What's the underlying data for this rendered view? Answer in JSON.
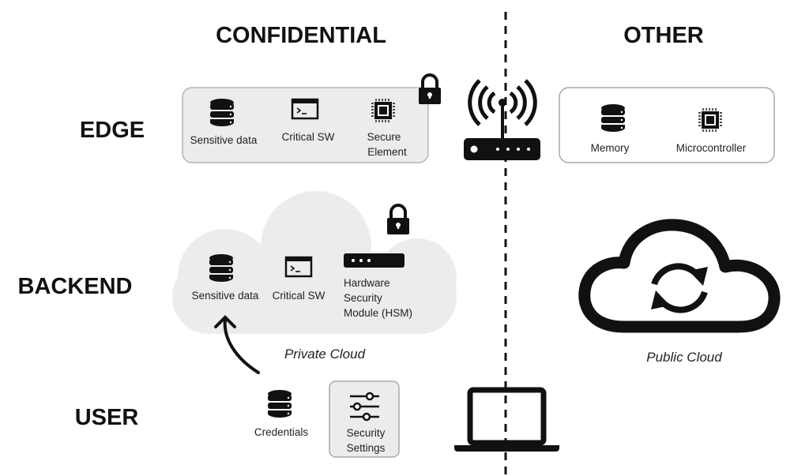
{
  "columns": {
    "confidential": "CONFIDENTIAL",
    "other": "OTHER"
  },
  "rows": {
    "edge": "EDGE",
    "backend": "BACKEND",
    "user": "USER"
  },
  "edge": {
    "confidential_items": [
      {
        "icon": "database-icon",
        "label": "Sensitive data"
      },
      {
        "icon": "terminal-icon",
        "label": "Critical SW"
      },
      {
        "icon": "chip-icon",
        "label_lines": [
          "Secure",
          "Element"
        ]
      }
    ],
    "device_icon": "wifi-router-icon",
    "other_items": [
      {
        "icon": "database-icon",
        "label": "Memory"
      },
      {
        "icon": "chip-icon",
        "label": "Microcontroller"
      }
    ]
  },
  "backend": {
    "private_cloud": {
      "caption": "Private Cloud",
      "items": [
        {
          "icon": "database-icon",
          "label": "Sensitive data"
        },
        {
          "icon": "terminal-icon",
          "label": "Critical SW"
        },
        {
          "icon": "hsm-icon",
          "label_lines": [
            "Hardware",
            "Security",
            "Module (HSM)"
          ]
        }
      ]
    },
    "public_cloud": {
      "caption": "Public Cloud",
      "icon": "cloud-sync-icon"
    }
  },
  "user": {
    "items": [
      {
        "icon": "database-icon",
        "label": "Credentials"
      },
      {
        "icon": "sliders-icon",
        "label_lines": [
          "Security",
          "Settings"
        ]
      }
    ],
    "device_icon": "laptop-icon"
  },
  "colors": {
    "panel": "#ececec",
    "ink": "#111111"
  }
}
